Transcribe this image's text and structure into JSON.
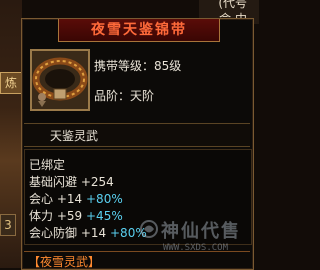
{
  "background": {
    "left_tab_1": "炼",
    "left_tab_2": "3",
    "right_top_1": "(代号",
    "right_top_2": "命 中"
  },
  "tooltip": {
    "title": "夜雪天鉴锦带",
    "icon": "belt-icon",
    "carry_level": "携带等级：85级",
    "grade": "品阶：天阶",
    "item_name": "天鉴灵武",
    "bound_status": "已绑定",
    "stats": [
      {
        "label": "基础闪避",
        "value": "+254",
        "percent": ""
      },
      {
        "label": "会心",
        "value": "+14",
        "percent": "+80%"
      },
      {
        "label": "体力",
        "value": "+59",
        "percent": "+45%"
      },
      {
        "label": "会心防御",
        "value": "+14",
        "percent": "+80%"
      }
    ],
    "set_name": "【夜雪灵武】"
  },
  "watermark": {
    "text": "神仙代售",
    "url": "WWW.SXDS.COM"
  },
  "colors": {
    "title": "#ff6a3a",
    "percent": "#5ad0f0",
    "set": "#ff8a30"
  }
}
